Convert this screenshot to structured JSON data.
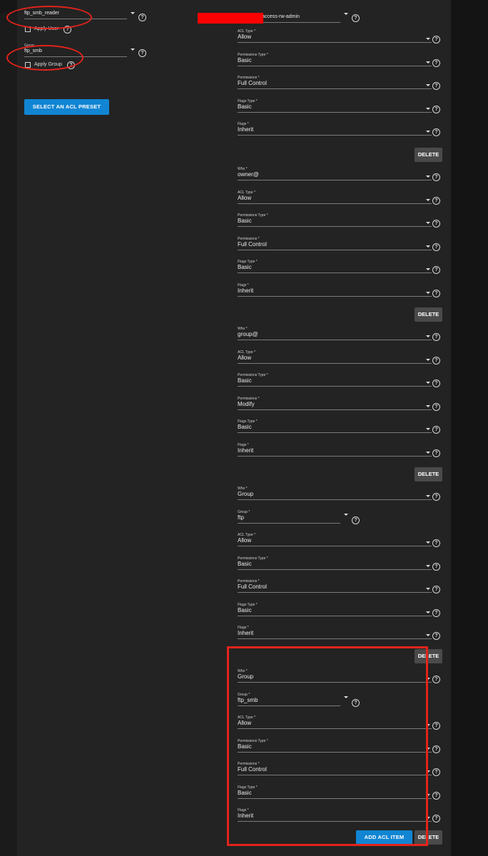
{
  "left": {
    "user_value": "ftp_smb_reader",
    "apply_user_label": "Apply User",
    "group_label": "Group",
    "group_value": "ftp_smb",
    "apply_group_label": "Apply Group",
    "preset_button": "SELECT AN ACL PRESET"
  },
  "top_fragment": {
    "group_value_visible": "access-rw-admin"
  },
  "entries": [
    {
      "who_label": "Who *",
      "who": null,
      "acl_type_label": "ACL Type *",
      "acl_type": "Allow",
      "perm_type_label": "Permissions Type *",
      "perm_type": "Basic",
      "perm_label": "Permissions *",
      "perm": "Full Control",
      "flags_type_label": "Flags Type *",
      "flags_type": "Basic",
      "flags_label": "Flags *",
      "flags": "Inherit",
      "delete": "DELETE"
    },
    {
      "who_label": "Who *",
      "who": "owner@",
      "acl_type_label": "ACL Type *",
      "acl_type": "Allow",
      "perm_type_label": "Permissions Type *",
      "perm_type": "Basic",
      "perm_label": "Permissions *",
      "perm": "Full Control",
      "flags_type_label": "Flags Type *",
      "flags_type": "Basic",
      "flags_label": "Flags *",
      "flags": "Inherit",
      "delete": "DELETE"
    },
    {
      "who_label": "Who *",
      "who": "group@",
      "acl_type_label": "ACL Type *",
      "acl_type": "Allow",
      "perm_type_label": "Permissions Type *",
      "perm_type": "Basic",
      "perm_label": "Permissions *",
      "perm": "Modify",
      "flags_type_label": "Flags Type *",
      "flags_type": "Basic",
      "flags_label": "Flags *",
      "flags": "Inherit",
      "delete": "DELETE"
    },
    {
      "who_label": "Who *",
      "who": "Group",
      "group_label": "Group *",
      "group": "ftp",
      "acl_type_label": "ACL Type *",
      "acl_type": "Allow",
      "perm_type_label": "Permissions Type *",
      "perm_type": "Basic",
      "perm_label": "Permissions *",
      "perm": "Full Control",
      "flags_type_label": "Flags Type *",
      "flags_type": "Basic",
      "flags_label": "Flags *",
      "flags": "Inherit",
      "delete": "DELETE"
    },
    {
      "who_label": "Who *",
      "who": "Group",
      "group_label": "Group *",
      "group": "ftp_smb",
      "acl_type_label": "ACL Type *",
      "acl_type": "Allow",
      "perm_type_label": "Permissions Type *",
      "perm_type": "Basic",
      "perm_label": "Permissions *",
      "perm": "Full Control",
      "flags_type_label": "Flags Type *",
      "flags_type": "Basic",
      "flags_label": "Flags *",
      "flags": "Inherit",
      "delete": "DELETE"
    }
  ],
  "add_button": "ADD ACL ITEM",
  "annotation_color": "#e5231b",
  "accent_color": "#1185d3"
}
